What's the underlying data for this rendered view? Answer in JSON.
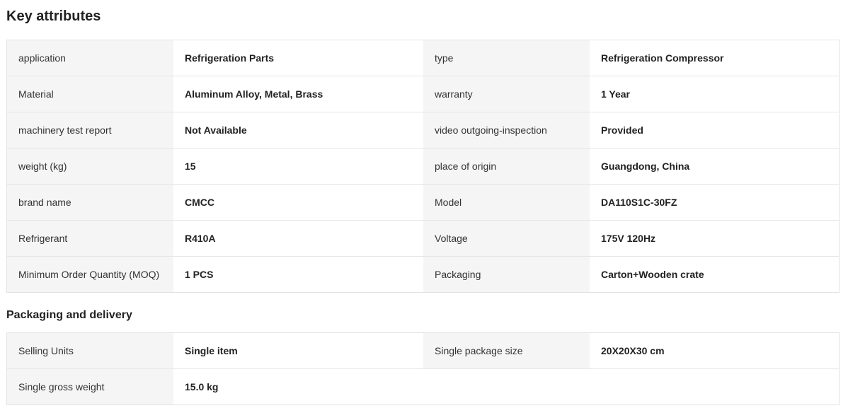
{
  "key_attributes": {
    "title": "Key attributes",
    "rows": [
      [
        "application",
        "Refrigeration Parts",
        "type",
        "Refrigeration Compressor"
      ],
      [
        "Material",
        "Aluminum Alloy, Metal, Brass",
        "warranty",
        "1 Year"
      ],
      [
        "machinery test report",
        "Not Available",
        "video outgoing-inspection",
        "Provided"
      ],
      [
        "weight (kg)",
        "15",
        "place of origin",
        "Guangdong, China"
      ],
      [
        "brand name",
        "CMCC",
        "Model",
        "DA110S1C-30FZ"
      ],
      [
        "Refrigerant",
        "R410A",
        "Voltage",
        "175V 120Hz"
      ],
      [
        "Minimum Order Quantity (MOQ)",
        "1 PCS",
        "Packaging",
        "Carton+Wooden crate"
      ]
    ]
  },
  "packaging_delivery": {
    "title": "Packaging and delivery",
    "rows": [
      [
        "Selling Units",
        "Single item",
        "Single package size",
        "20X20X30 cm"
      ],
      [
        "Single gross weight",
        "15.0 kg",
        "",
        ""
      ]
    ]
  }
}
